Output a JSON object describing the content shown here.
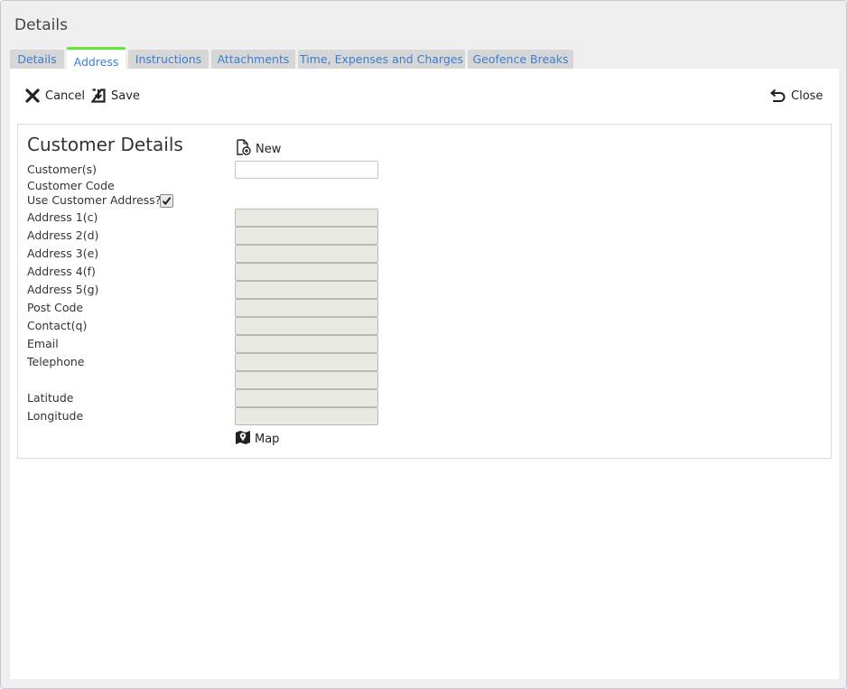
{
  "window": {
    "title": "Details"
  },
  "tabs": [
    {
      "label": "Details",
      "active": false
    },
    {
      "label": "Address",
      "active": true
    },
    {
      "label": "Instructions",
      "active": false
    },
    {
      "label": "Attachments",
      "active": false
    },
    {
      "label": "Time, Expenses and Charges",
      "active": false
    },
    {
      "label": "Geofence Breaks",
      "active": false
    }
  ],
  "toolbar": {
    "cancel_label": "Cancel",
    "save_label": "Save",
    "close_label": "Close"
  },
  "customer": {
    "title": "Customer Details",
    "new_label": "New",
    "map_label": "Map",
    "use_address_label": "Use Customer Address?",
    "use_address_checked": true,
    "fields": {
      "customers": {
        "label": "Customer(s)",
        "value": ""
      },
      "code": {
        "label": "Customer Code"
      },
      "address1": {
        "label": "Address 1(c)",
        "value": ""
      },
      "address2": {
        "label": "Address 2(d)",
        "value": ""
      },
      "address3": {
        "label": "Address 3(e)",
        "value": ""
      },
      "address4": {
        "label": "Address 4(f)",
        "value": ""
      },
      "address5": {
        "label": "Address 5(g)",
        "value": ""
      },
      "postcode": {
        "label": "Post Code",
        "value": ""
      },
      "contact": {
        "label": "Contact(q)",
        "value": ""
      },
      "email": {
        "label": "Email",
        "value": ""
      },
      "telephone": {
        "label": "Telephone",
        "value": "",
        "value2": ""
      },
      "latitude": {
        "label": "Latitude",
        "value": ""
      },
      "longitude": {
        "label": "Longitude",
        "value": ""
      }
    }
  }
}
